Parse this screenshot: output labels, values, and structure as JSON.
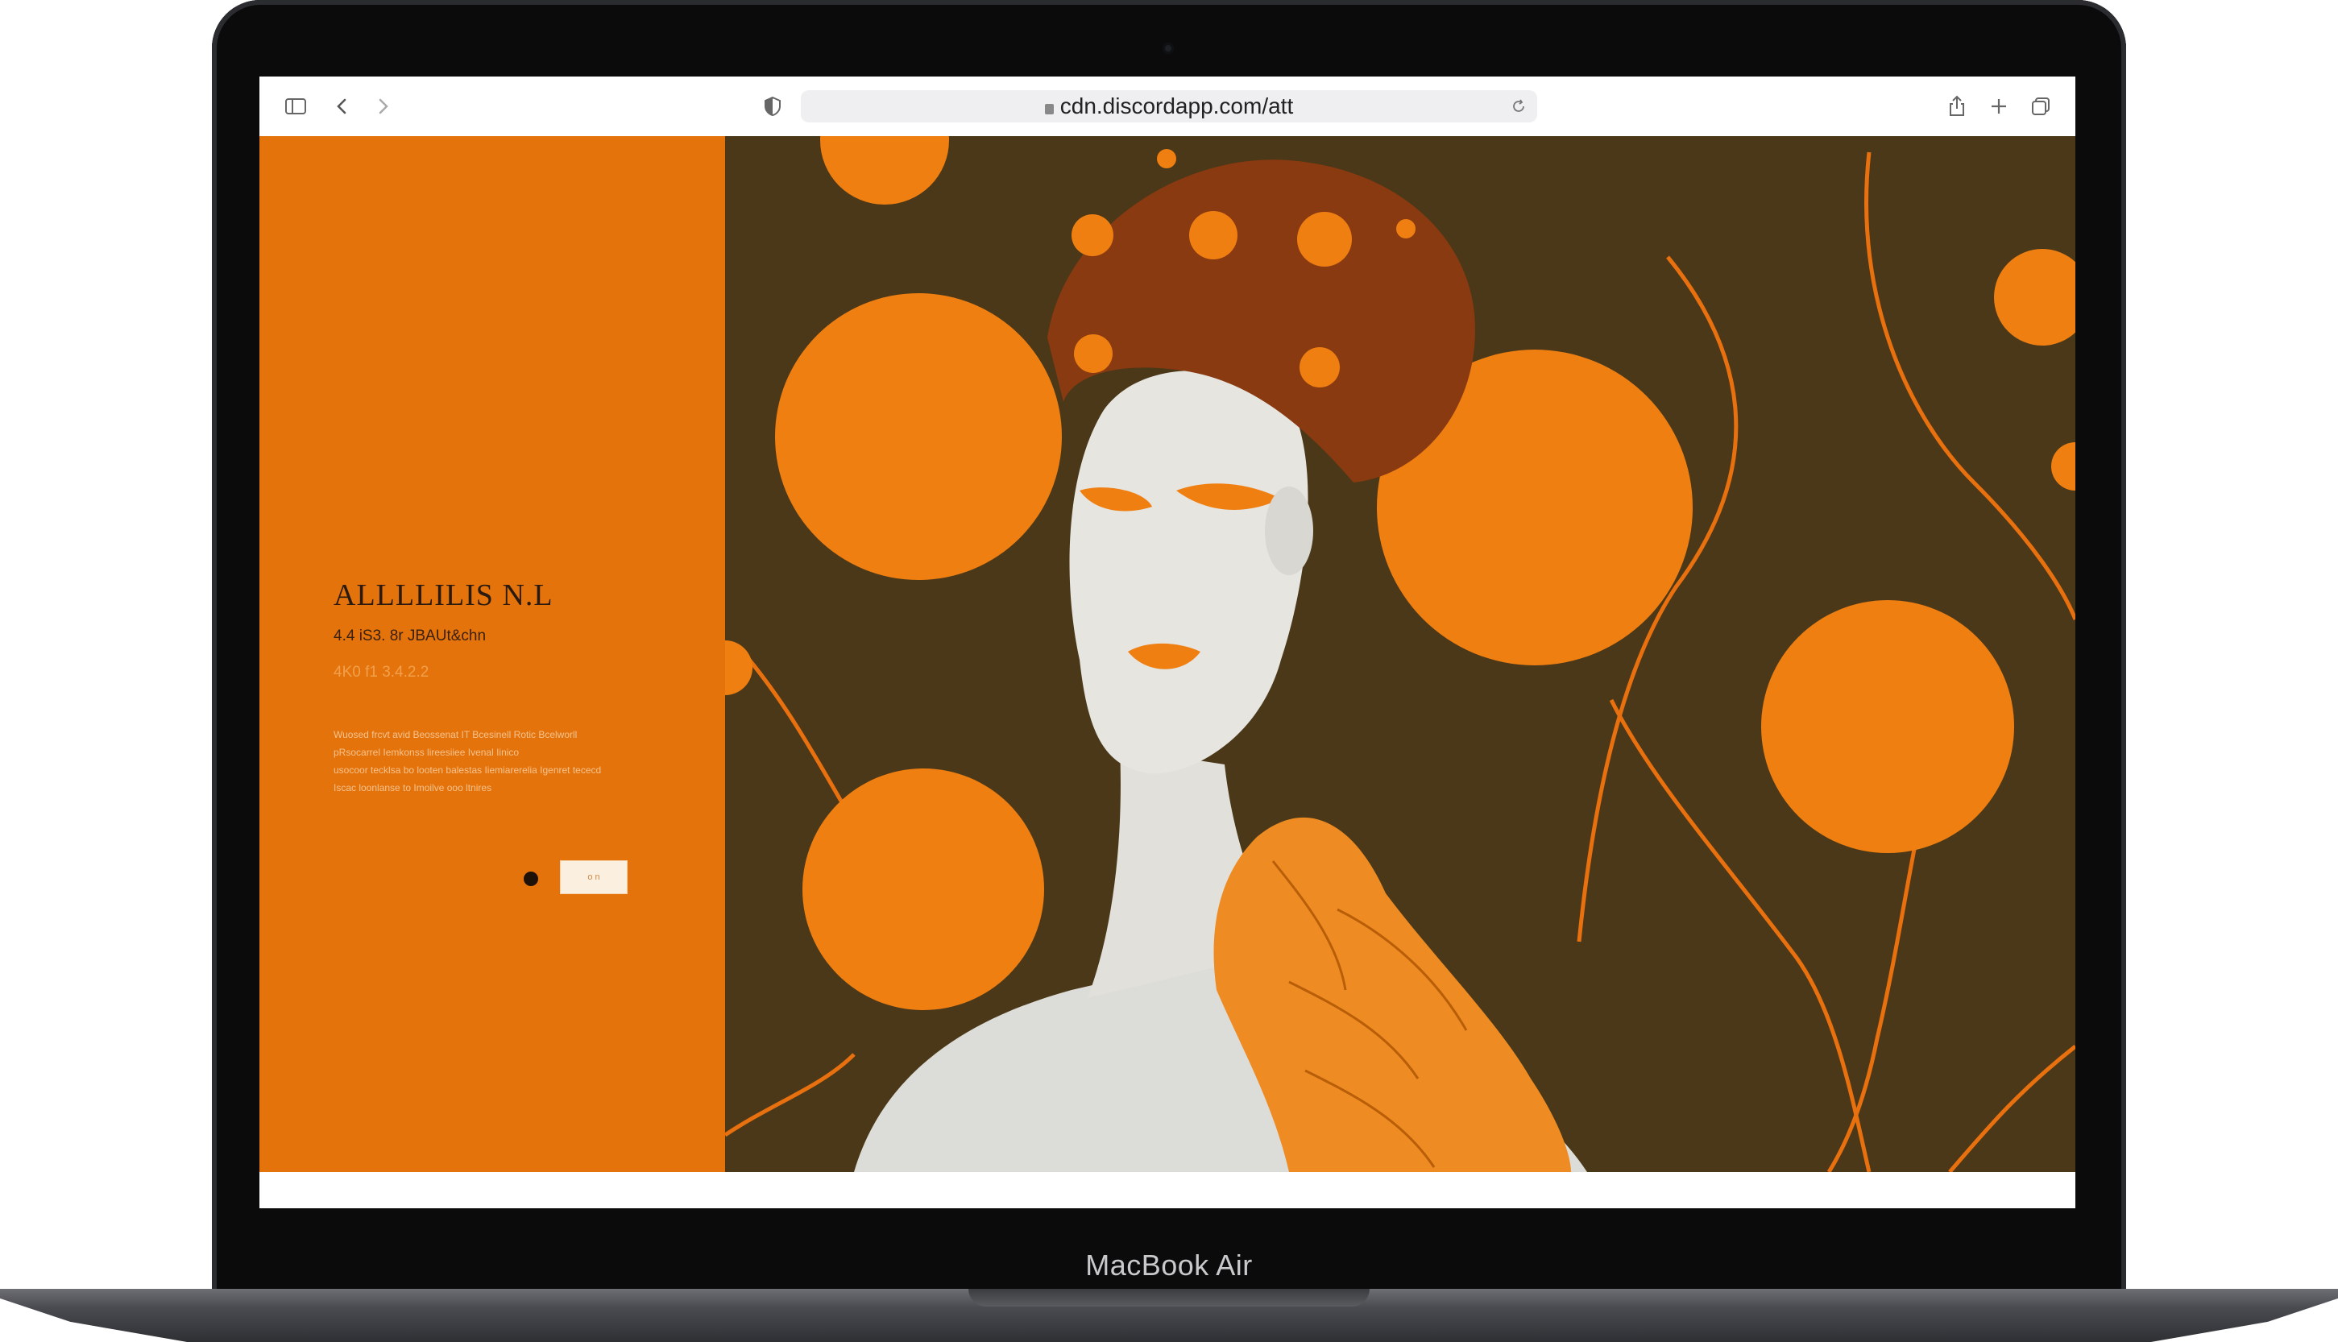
{
  "browser": {
    "url": "cdn.discordapp.com/att",
    "icons": [
      "sidebar-icon",
      "back-icon",
      "forward-icon",
      "shield-icon",
      "lock-icon",
      "reload-icon",
      "share-icon",
      "new-tab-icon",
      "tabs-icon"
    ]
  },
  "page": {
    "title": "ALLLLILIS N.L",
    "subtitle": "4.4 iS3. 8r JBAUt&chn",
    "tagline": "4K0 f1 3.4.2.2",
    "body_lines": [
      "Wuosed frcvt avid Beossenat IT Bcesinell Rotic Bcelworll",
      "pRsocarrel Iemkonss lireesiiee Ivenal Iinico",
      "usocoor tecklsa bo looten balestas Iiemiarerelia Igenret tececd",
      "Iscac loonlanse to Imoilve ooo ltnires"
    ],
    "cta_label": "o   n"
  },
  "colors": {
    "panel_orange": "#e4730c",
    "art_background": "#4b3818",
    "circle_orange": "#f07f12"
  },
  "device": {
    "label": "MacBook Air"
  }
}
